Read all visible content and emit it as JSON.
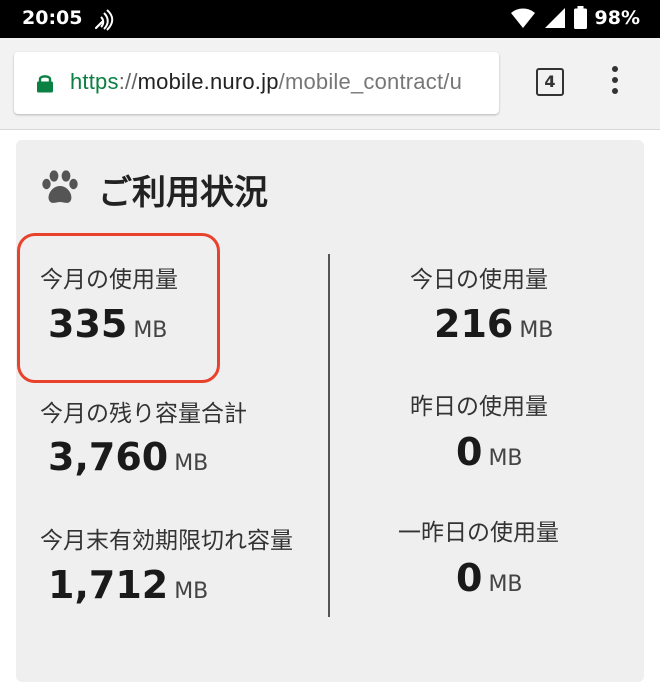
{
  "status_bar": {
    "time": "20:05",
    "battery": "98%"
  },
  "browser": {
    "url_scheme": "https",
    "url_separator": "://",
    "url_host": "mobile.nuro.jp",
    "url_path": "/mobile_contract/u",
    "tab_count": "4"
  },
  "card": {
    "title": "ご利用状況",
    "left": {
      "month_usage": {
        "label": "今月の使用量",
        "value": "335",
        "unit": "MB"
      },
      "month_remaining": {
        "label": "今月の残り容量合計",
        "value": "3,760",
        "unit": "MB"
      },
      "month_expiring": {
        "label": "今月末有効期限切れ容量",
        "value": "1,712",
        "unit": "MB"
      }
    },
    "right": {
      "today_usage": {
        "label": "今日の使用量",
        "value": "216",
        "unit": "MB"
      },
      "yesterday_usage": {
        "label": "昨日の使用量",
        "value": "0",
        "unit": "MB"
      },
      "day_before_usage": {
        "label": "一昨日の使用量",
        "value": "0",
        "unit": "MB"
      }
    }
  },
  "colors": {
    "highlight": "#e8412c",
    "secure_scheme": "#0b8043"
  }
}
